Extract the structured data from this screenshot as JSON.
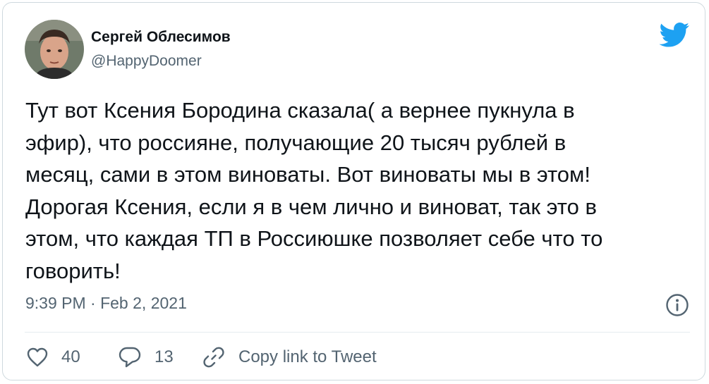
{
  "user": {
    "display_name": "Сергей Облесимов",
    "handle": "@HappyDoomer",
    "avatar_icon": "profile-photo"
  },
  "platform": {
    "logo_icon": "twitter-bird-icon",
    "brand_color": "#1da1f2"
  },
  "tweet": {
    "text": "Тут вот Ксения Бородина сказала( а вернее пукнула в\nэфир), что россияне, получающие 20 тысяч рублей в\nмесяц, сами в этом виноваты. Вот виноваты мы в этом!\nДорогая Ксения, если я в чем лично и виноват, так это в\nэтом, что каждая ТП в Россиюшке позволяет себе что то\nговорить!",
    "timestamp": "9:39 PM · Feb 2, 2021"
  },
  "actions": {
    "likes_count": "40",
    "replies_count": "13",
    "copy_link_label": "Copy link to Tweet"
  },
  "colors": {
    "text": "#0f1419",
    "secondary": "#536471",
    "border": "#cfd9de"
  }
}
